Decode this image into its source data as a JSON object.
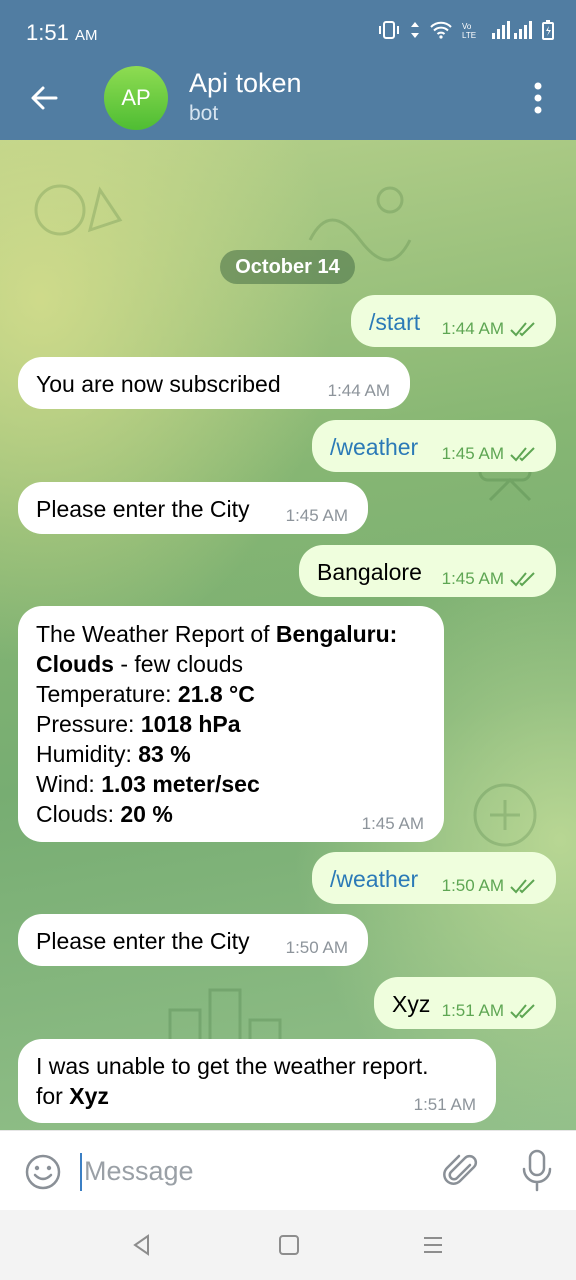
{
  "status_bar": {
    "time": "1:51",
    "ampm": "AM"
  },
  "header": {
    "avatar_initials": "AP",
    "title": "Api token",
    "subtitle": "bot"
  },
  "chat": {
    "date": "October 14",
    "messages": [
      {
        "dir": "out",
        "text": "/start",
        "time": "1:44 AM"
      },
      {
        "dir": "in",
        "text": "You are now subscribed",
        "time": "1:44 AM"
      },
      {
        "dir": "out",
        "text": "/weather",
        "time": "1:45 AM"
      },
      {
        "dir": "in",
        "text": "Please enter the City",
        "time": "1:45 AM"
      },
      {
        "dir": "out",
        "text": "Bangalore",
        "time": "1:45 AM"
      },
      {
        "dir": "in",
        "time": "1:45 AM",
        "report": {
          "l1_pre": "The Weather Report of ",
          "l1_city": "Bengaluru:",
          "l2_bold": "Clouds",
          "l2_rest": " - few clouds",
          "temp_label": "Temperature: ",
          "temp_value": "21.8 °C",
          "pressure_label": "Pressure: ",
          "pressure_value": "1018 hPa",
          "humidity_label": "Humidity: ",
          "humidity_value": "83 %",
          "wind_label": "Wind: ",
          "wind_value": "1.03 meter/sec",
          "clouds_label": "Clouds: ",
          "clouds_value": "20 %"
        }
      },
      {
        "dir": "out",
        "text": "/weather",
        "time": "1:50 AM"
      },
      {
        "dir": "in",
        "text": "Please enter the City",
        "time": "1:50 AM"
      },
      {
        "dir": "out",
        "text": "Xyz",
        "time": "1:51 AM"
      },
      {
        "dir": "in",
        "time": "1:51 AM",
        "line1": "I was unable to get the weather report.",
        "line2_pre": "for ",
        "line2_bold": "Xyz"
      }
    ]
  },
  "input": {
    "placeholder": "Message"
  },
  "colors": {
    "header": "#517da2",
    "out_bubble": "#effedd",
    "in_bubble": "#ffffff",
    "link": "#2b7ab7",
    "check": "#5ea653"
  }
}
